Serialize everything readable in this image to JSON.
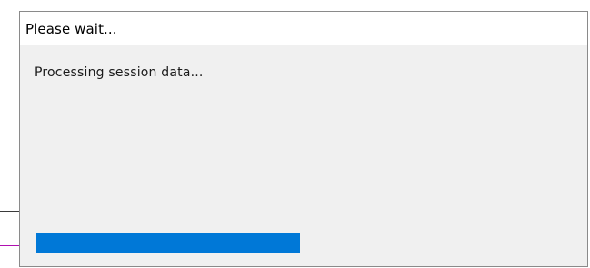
{
  "dialog": {
    "title": "Please wait...",
    "message": "Processing session data...",
    "progress": {
      "value": 0.5,
      "color": "#0078d7"
    }
  }
}
